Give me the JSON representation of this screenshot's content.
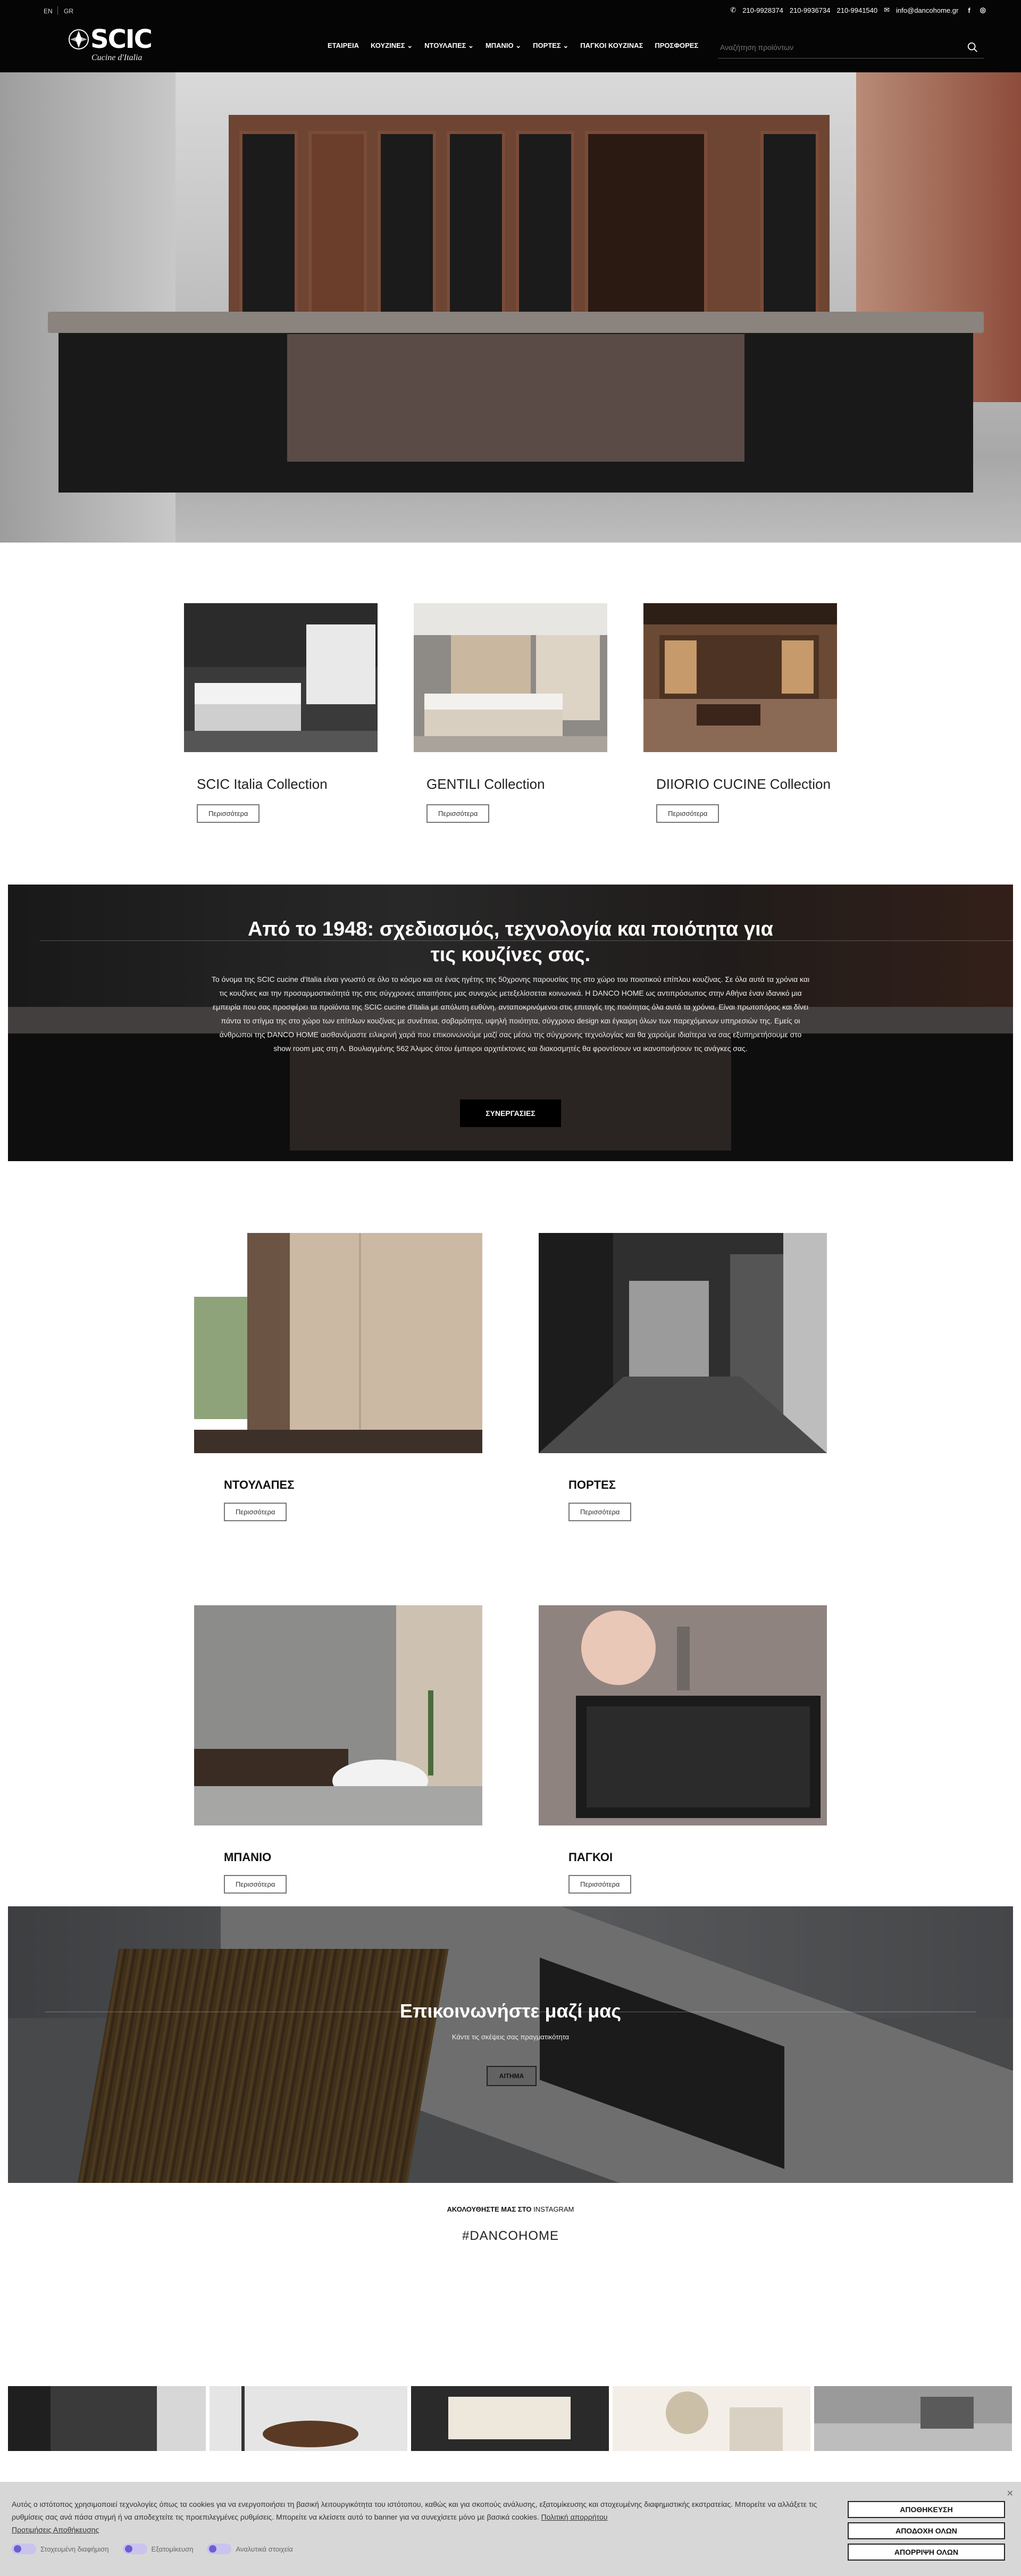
{
  "header": {
    "lang_en": "EN",
    "lang_gr": "GR",
    "phone1": "210-9928374",
    "phone2": "210-9936734",
    "phone3": "210-9941540",
    "email": "info@dancohome.gr",
    "logo_text": "SCIC",
    "logo_sub": "Cucine d'Italia",
    "nav": [
      "ΕΤΑΙΡΕΙΑ",
      "ΚΟΥΖΙΝΕΣ",
      "ΝΤΟΥΛΑΠΕΣ",
      "ΜΠΑΝΙΟ",
      "ΠΟΡΤΕΣ",
      "ΠΑΓΚΟΙ ΚΟΥΖΙΝΑΣ",
      "ΠΡΟΣΦΟΡΕΣ"
    ],
    "search_placeholder": "Αναζήτηση προϊόντων"
  },
  "collections": [
    {
      "title": "SCIC Italia Collection",
      "button": "Περισσότερα"
    },
    {
      "title": "GENTILI Collection",
      "button": "Περισσότερα"
    },
    {
      "title": "DIIORIO CUCINE Collection",
      "button": "Περισσότερα"
    }
  ],
  "about_banner": {
    "title": "Από το 1948: σχεδιασμός, τεχνολογία και ποιότητα για τις κουζίνες σας.",
    "text": "Το όνομα της SCIC cucine d'Italia είναι γνωστό σε όλο το κόσμο και σε ένας ηγέτης της 50χρονης παρουσίας της στο χώρο του ποιοτικού επίπλου κουζίνας. Σε όλα αυτά τα χρόνια και τις κουζίνες και την προσαρμοστικότητά της στις σύγχρονες απαιτήσεις μας συνεχώς μετεξελίσσεται κοινωνικά. Η DANCO HOME ως αντιπρόσωπος στην Αθήνα έναν ιδανικό μια εμπειρία που σας προσφέρει τα προϊόντα της SCIC cucine d'Italia με απόλυτη ευθύνη, ανταποκρινόμενοι στις επιταγές της ποιότητας όλα αυτά τα χρόνια. Είναι πρωτοπόρος και δίνει πάντα το στίγμα της στο χώρο των επίπλων κουζίνας με συνέπεια, σοβαρότητα, υψηλή ποιότητα, σύγχρονο design και έγκαιρη όλων των παρεχόμενων υπηρεσιών της. Εμείς οι άνθρωποι της DANCO HOME αισθανόμαστε ειλικρινή χαρά που επικοινωνούμε μαζί σας μέσω της σύγχρονης τεχνολογίας και θα χαρούμε ιδιαίτερα να σας εξυπηρετήσουμε στο show room μας στη Λ. Βουλιαγμένης 562 Άλιμος όπου έμπειροι αρχιτέκτονες και διακοσμητές θα φροντίσουν να ικανοποιήσουν τις ανάγκες σας.",
    "button": "ΣΥΝΕΡΓΑΣΙΕΣ"
  },
  "categories": [
    {
      "title": "ΝΤΟΥΛΑΠΕΣ",
      "button": "Περισσότερα"
    },
    {
      "title": "ΠΟΡΤΕΣ",
      "button": "Περισσότερα"
    },
    {
      "title": "ΜΠΑΝΙΟ",
      "button": "Περισσότερα"
    },
    {
      "title": "ΠΑΓΚΟΙ",
      "button": "Περισσότερα"
    }
  ],
  "contact_banner": {
    "title": "Επικοινωνήστε μαζί μας",
    "subtitle": "Κάντε τις σκέψεις σας πραγματικότητα",
    "button": "ΑΙΤΗΜΑ"
  },
  "instagram": {
    "label_bold": "ΑΚΟΛΟΥΘΗΣΤΕ ΜΑΣ ΣΤΟ",
    "label_light": "INSTAGRAM",
    "hashtag": "#DANCOHOME"
  },
  "cookie": {
    "text": "Αυτός ο ιστότοπος χρησιμοποιεί τεχνολογίες όπως τα cookies για να ενεργοποιήσει τη βασική λειτουργικότητα του ιστότοπου, καθώς και για σκοπούς ανάλυσης, εξατομίκευσης και στοχευμένης διαφημιστικής εκστρατείας. Μπορείτε να αλλάξετε τις ρυθμίσεις σας ανά πάσα στιγμή ή να αποδεχτείτε τις προεπιλεγμένες ρυθμίσεις. Μπορείτε να κλείσετε αυτό το banner για να συνεχίσετε μόνο με βασικά cookies.",
    "policy_link": "Πολιτική απορρήτου",
    "prefs_link": "Προτιμήσεις Αποθήκευσης",
    "toggles": [
      "Στοχευμένη διαφήμιση",
      "Εξατομίκευση",
      "Αναλυτικά στοιχεία"
    ],
    "btn_save": "ΑΠΟΘΗΚΕΥΣΗ",
    "btn_accept": "ΑΠΟΔΟΧΗ ΟΛΩΝ",
    "btn_reject": "ΑΠΟΡΡΙΨΗ ΟΛΩΝ"
  }
}
